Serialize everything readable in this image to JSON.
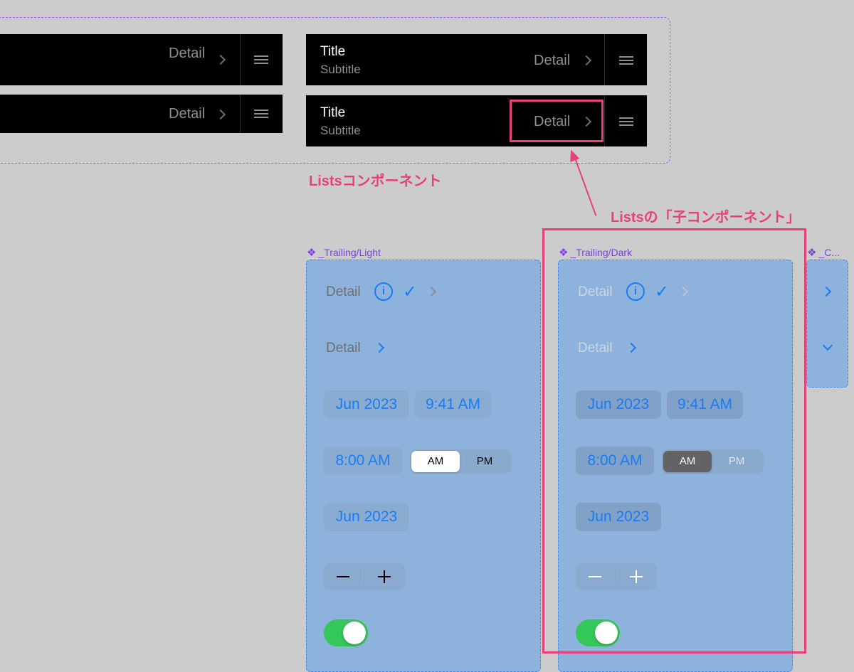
{
  "lists": {
    "rows": [
      {
        "detail": "Detail"
      },
      {
        "detail": "Detail"
      },
      {
        "title": "Title",
        "subtitle": "Subtitle",
        "detail": "Detail"
      },
      {
        "title": "Title",
        "subtitle": "Subtitle",
        "detail": "Detail"
      }
    ]
  },
  "annotations": {
    "lists_component": "Listsコンポーネント",
    "child_component": "Listsの「子コンポーネント」"
  },
  "components": {
    "light": {
      "label": "_Trailing/Light",
      "detail1": "Detail",
      "info_glyph": "i",
      "check_glyph": "✓",
      "detail2": "Detail",
      "date1": "Jun 2023",
      "time1": "9:41 AM",
      "time2": "8:00 AM",
      "am": "AM",
      "pm": "PM",
      "date2": "Jun 2023"
    },
    "dark": {
      "label": "_Trailing/Dark",
      "detail1": "Detail",
      "info_glyph": "i",
      "check_glyph": "✓",
      "detail2": "Detail",
      "date1": "Jun 2023",
      "time1": "9:41 AM",
      "time2": "8:00 AM",
      "am": "AM",
      "pm": "PM",
      "date2": "Jun 2023"
    },
    "third": {
      "label": "_C..."
    }
  },
  "colors": {
    "accent": "#1a7cf5",
    "highlight": "#e8407a",
    "component_label": "#7b3fe4",
    "toggle_on": "#34c759"
  }
}
